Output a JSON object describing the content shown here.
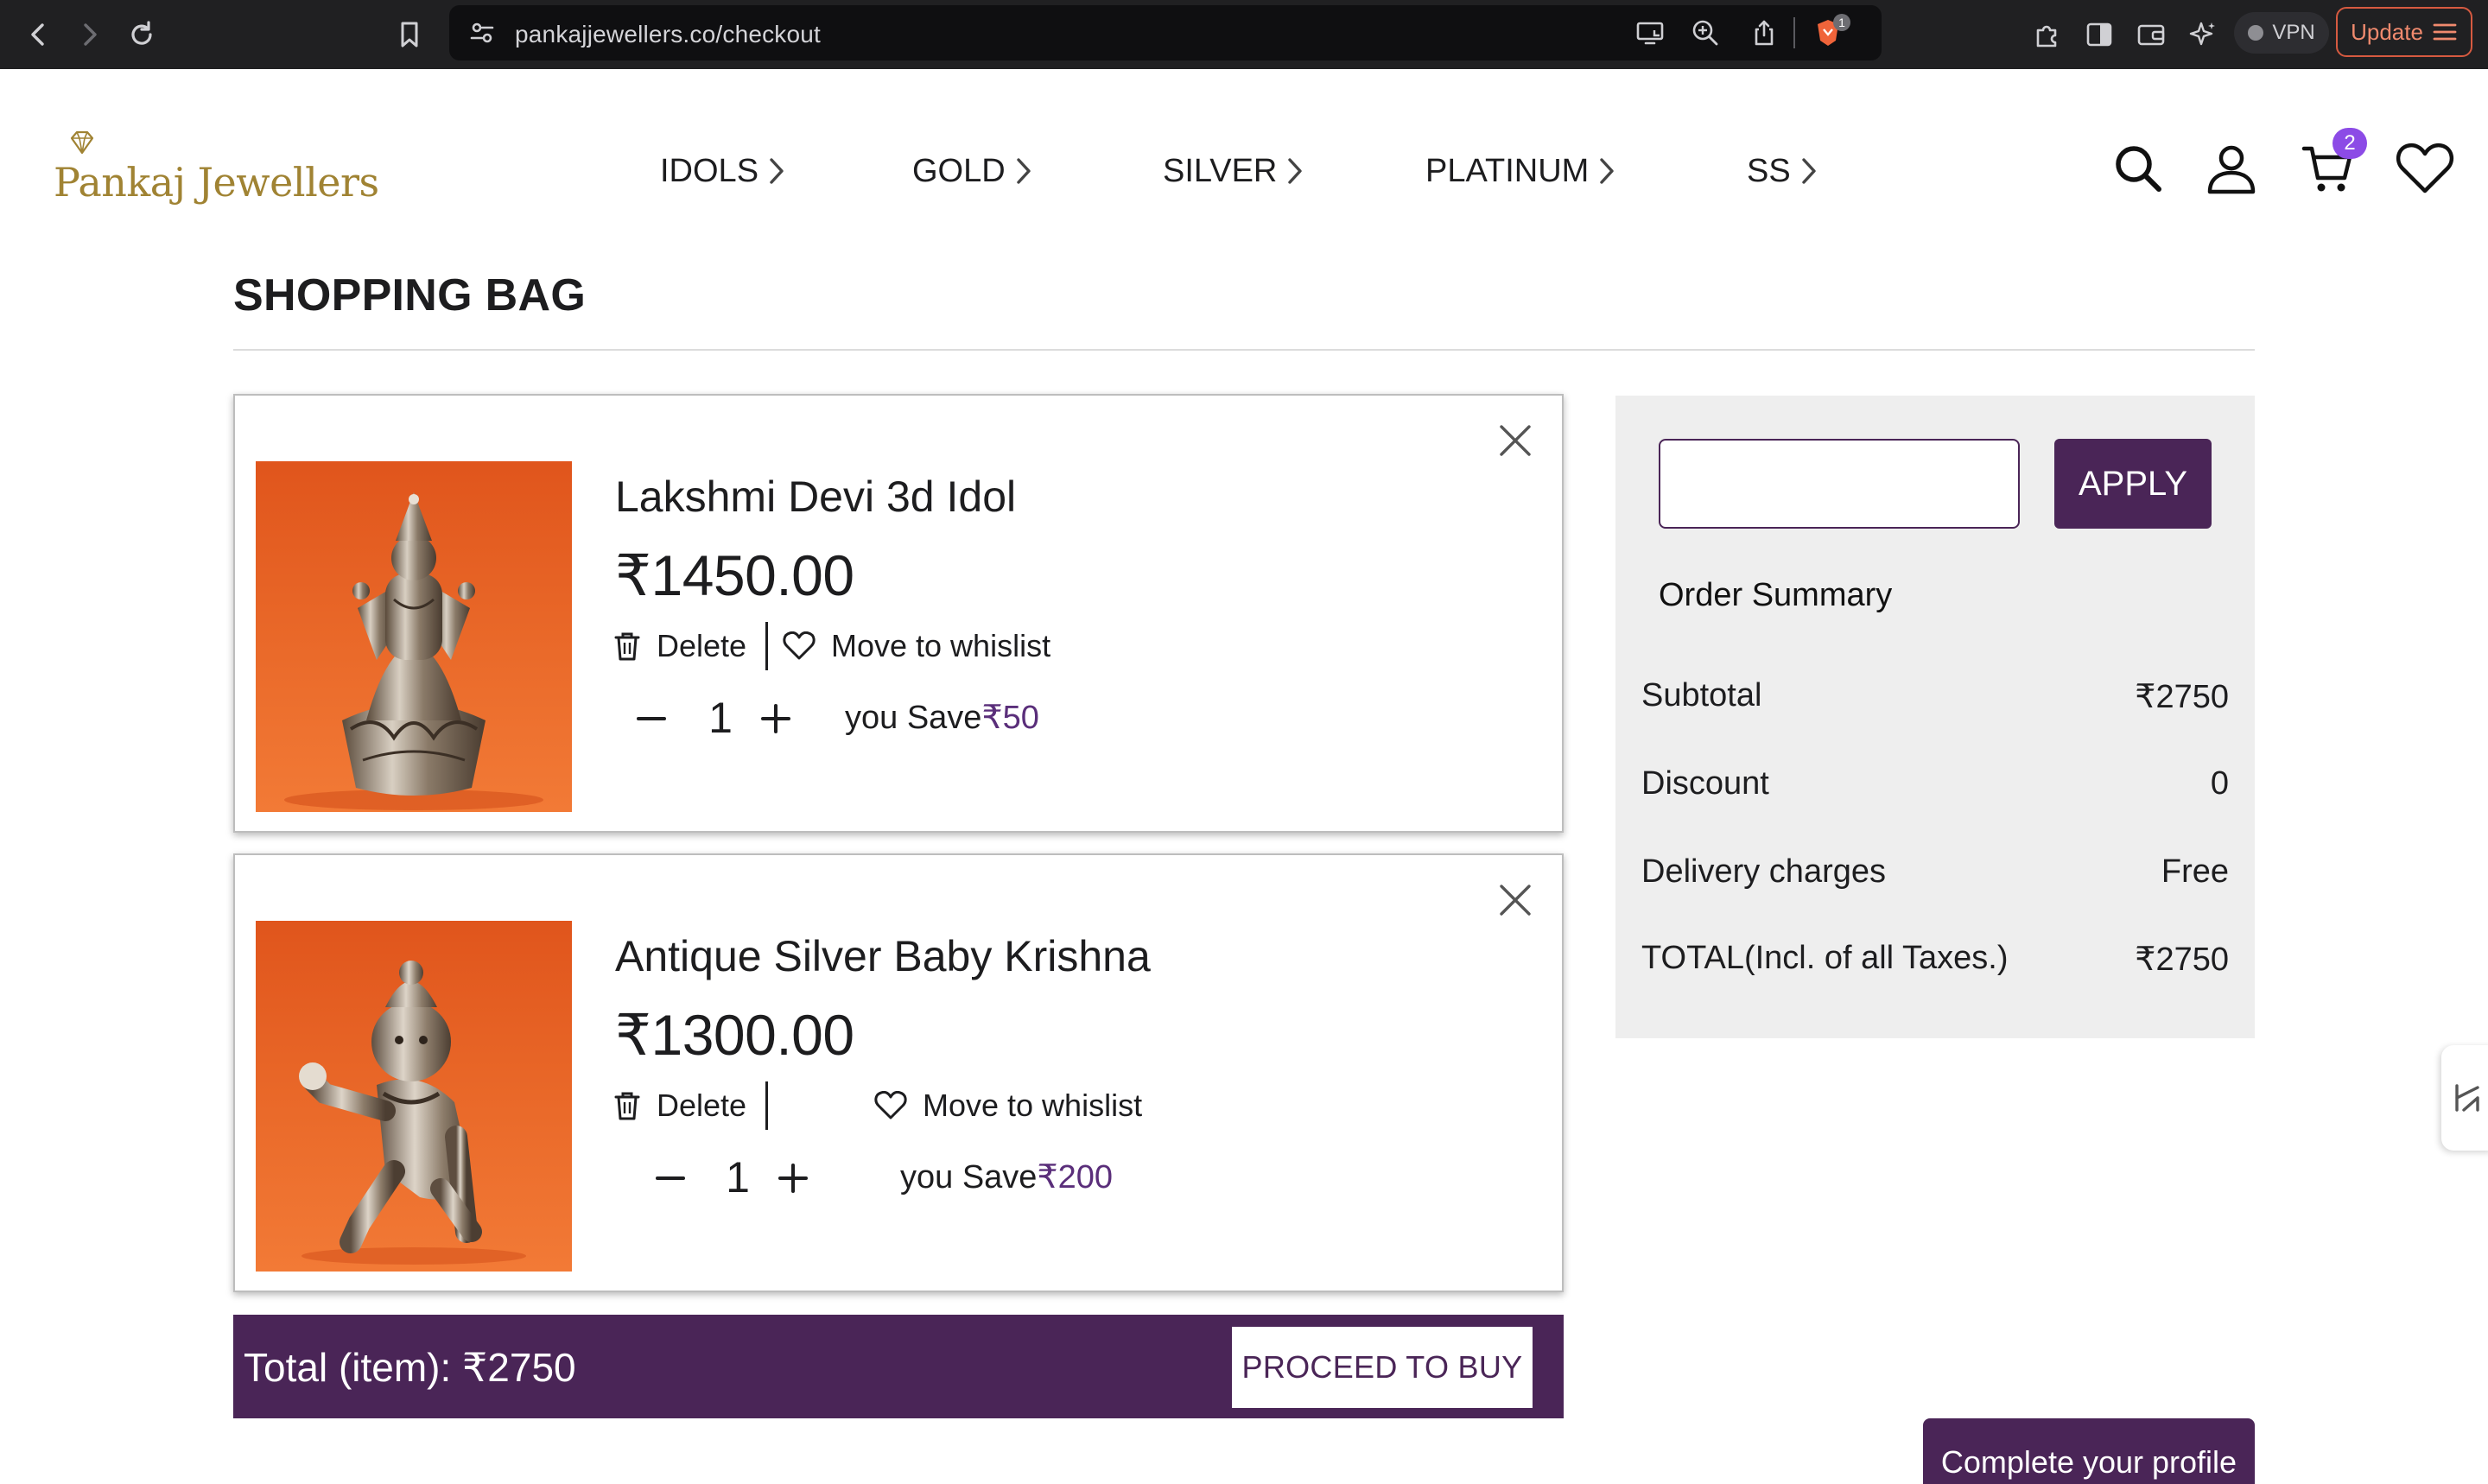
{
  "browser": {
    "url": "pankajjewellers.co/checkout",
    "vpn_label": "VPN",
    "update_label": "Update",
    "shield_badge": "1"
  },
  "site": {
    "logo_text": "Pankaj Jewellers",
    "nav": [
      {
        "label": "IDOLS"
      },
      {
        "label": "GOLD"
      },
      {
        "label": "SILVER"
      },
      {
        "label": "PLATINUM"
      },
      {
        "label": "SS"
      }
    ],
    "cart_count": "2"
  },
  "page": {
    "title": "SHOPPING BAG"
  },
  "items": [
    {
      "name": "Lakshmi Devi 3d Idol",
      "price": "₹1450.00",
      "delete_label": "Delete",
      "wishlist_label": "Move to whislist",
      "quantity": "1",
      "save_label": "you Save",
      "save_amount": "₹50"
    },
    {
      "name": "Antique Silver Baby Krishna",
      "price": "₹1300.00",
      "delete_label": "Delete",
      "wishlist_label": "Move to whislist",
      "quantity": "1",
      "save_label": "you Save",
      "save_amount": "₹200"
    }
  ],
  "total_bar": {
    "label": "Total (item):  ₹2750",
    "proceed_label": "PROCEED TO BUY"
  },
  "summary": {
    "coupon_value": "",
    "apply_label": "APPLY",
    "title": "Order Summary",
    "rows": [
      {
        "label": "Subtotal",
        "value": "₹2750"
      },
      {
        "label": "Discount",
        "value": "0"
      },
      {
        "label": "Delivery charges",
        "value": "Free"
      },
      {
        "label": "TOTAL(Incl. of all Taxes.)",
        "value": "₹2750"
      }
    ]
  },
  "profile": {
    "label": "Complete your profile"
  },
  "colors": {
    "brand_purple": "#4a2557",
    "logo_gold": "#a08333",
    "cart_badge": "#8c4be6",
    "image_orange": "#e8601f"
  }
}
